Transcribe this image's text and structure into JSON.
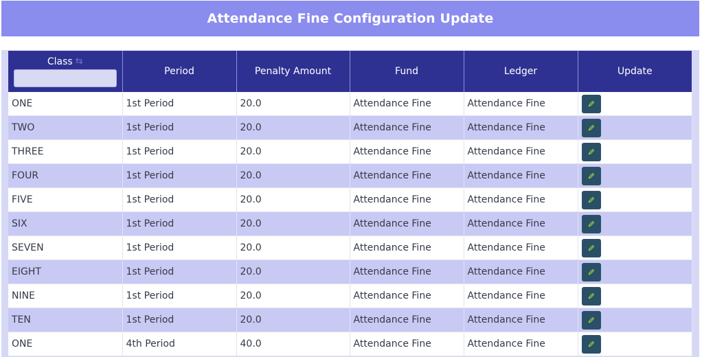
{
  "header": {
    "title": "Attendance Fine Configuration Update"
  },
  "table": {
    "columns": {
      "class": "Class",
      "period": "Period",
      "penalty_amount": "Penalty Amount",
      "fund": "Fund",
      "ledger": "Ledger",
      "update": "Update"
    },
    "class_filter": {
      "value": "",
      "placeholder": ""
    },
    "sort_icon": "sort-arrows-icon",
    "edit_icon": "pencil-icon",
    "rows": [
      {
        "class": "ONE",
        "period": "1st Period",
        "penalty": "20.0",
        "fund": "Attendance Fine",
        "ledger": "Attendance Fine"
      },
      {
        "class": "TWO",
        "period": "1st Period",
        "penalty": "20.0",
        "fund": "Attendance Fine",
        "ledger": "Attendance Fine"
      },
      {
        "class": "THREE",
        "period": "1st Period",
        "penalty": "20.0",
        "fund": "Attendance Fine",
        "ledger": "Attendance Fine"
      },
      {
        "class": "FOUR",
        "period": "1st Period",
        "penalty": "20.0",
        "fund": "Attendance Fine",
        "ledger": "Attendance Fine"
      },
      {
        "class": "FIVE",
        "period": "1st Period",
        "penalty": "20.0",
        "fund": "Attendance Fine",
        "ledger": "Attendance Fine"
      },
      {
        "class": "SIX",
        "period": "1st Period",
        "penalty": "20.0",
        "fund": "Attendance Fine",
        "ledger": "Attendance Fine"
      },
      {
        "class": "SEVEN",
        "period": "1st Period",
        "penalty": "20.0",
        "fund": "Attendance Fine",
        "ledger": "Attendance Fine"
      },
      {
        "class": "EIGHT",
        "period": "1st Period",
        "penalty": "20.0",
        "fund": "Attendance Fine",
        "ledger": "Attendance Fine"
      },
      {
        "class": "NINE",
        "period": "1st Period",
        "penalty": "20.0",
        "fund": "Attendance Fine",
        "ledger": "Attendance Fine"
      },
      {
        "class": "TEN",
        "period": "1st Period",
        "penalty": "20.0",
        "fund": "Attendance Fine",
        "ledger": "Attendance Fine"
      },
      {
        "class": "ONE",
        "period": "4th Period",
        "penalty": "40.0",
        "fund": "Attendance Fine",
        "ledger": "Attendance Fine"
      }
    ]
  },
  "colors": {
    "banner": "#8a8cee",
    "header_row": "#2e3192",
    "row_even": "#c8caf4",
    "row_odd": "#ffffff",
    "edit_button": "#2a5068",
    "edit_icon": "#9bd23a"
  }
}
